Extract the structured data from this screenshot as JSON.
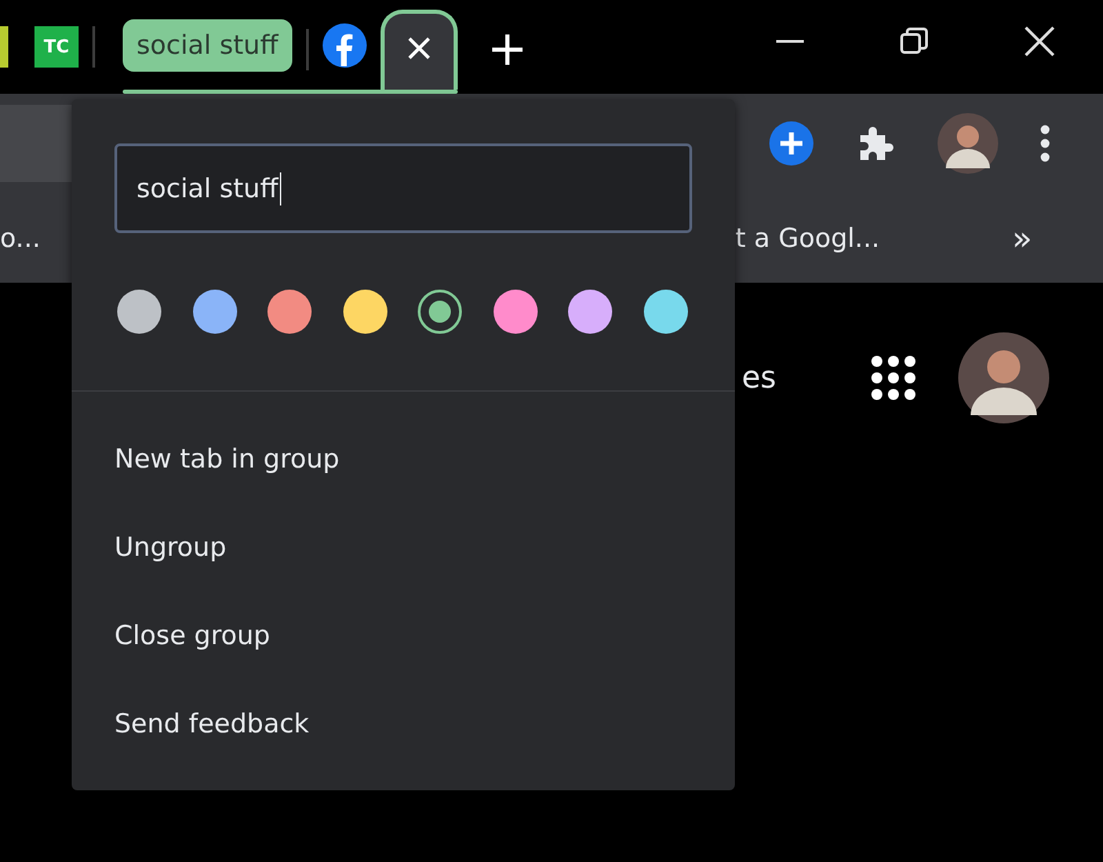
{
  "tab_strip": {
    "favicon_text": "TC"
  },
  "group": {
    "title": "social stuff"
  },
  "bookmarks": [
    {
      "label": "o..."
    },
    {
      "label": "t a Googl..."
    }
  ],
  "bookmarks_overflow": "»",
  "page": {
    "partial_link": "es"
  },
  "group_editor": {
    "name_field": {
      "value": "social stuff"
    },
    "colors": [
      {
        "color": "#bdc1c6",
        "selected": false
      },
      {
        "color": "#8ab4f8",
        "selected": false
      },
      {
        "color": "#f28b82",
        "selected": false
      },
      {
        "color": "#fdd663",
        "selected": false
      },
      {
        "color": "#81c995",
        "selected": true
      },
      {
        "color": "#ff8bcb",
        "selected": false
      },
      {
        "color": "#d7aefb",
        "selected": false
      },
      {
        "color": "#78d9ec",
        "selected": false
      }
    ],
    "menu": [
      "New tab in group",
      "Ungroup",
      "Close group",
      "Send feedback"
    ]
  }
}
